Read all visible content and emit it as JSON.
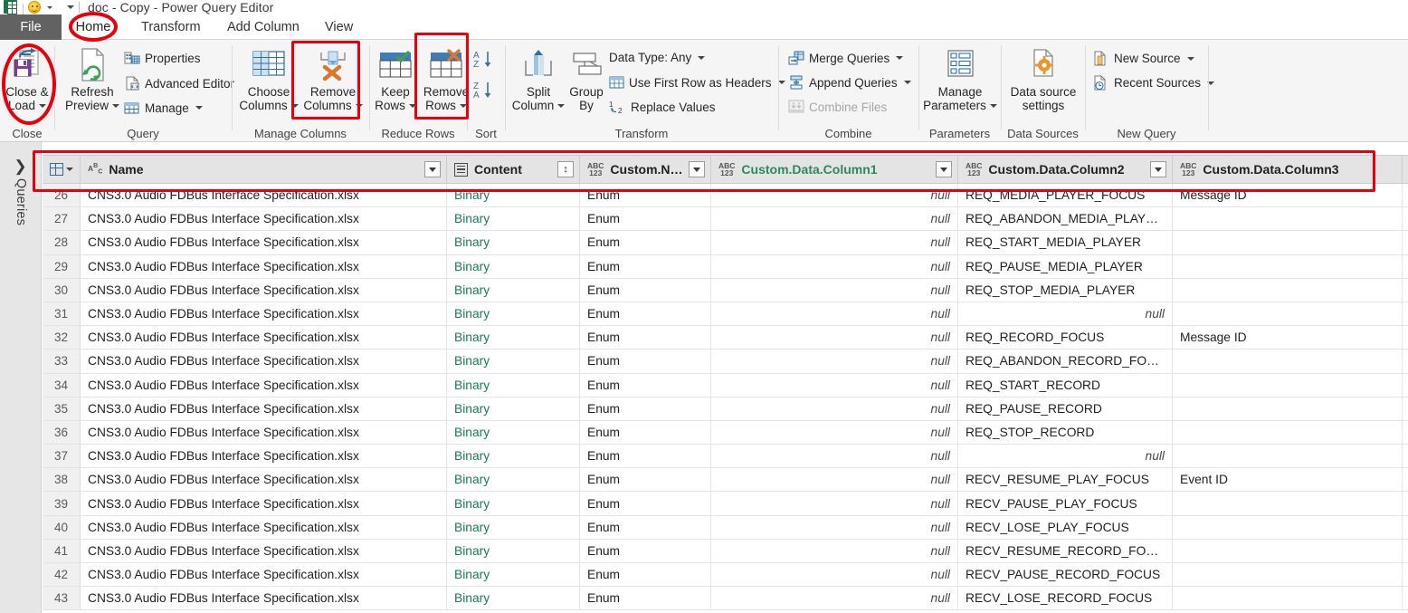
{
  "window": {
    "title": "doc - Copy - Power Query Editor",
    "qat_icons": [
      "excel-icon",
      "smiley-icon",
      "customize-quick-access-toolbar-icon"
    ]
  },
  "tabs": {
    "file_label": "File",
    "items": [
      {
        "label": "Home",
        "active": true
      },
      {
        "label": "Transform",
        "active": false
      },
      {
        "label": "Add Column",
        "active": false
      },
      {
        "label": "View",
        "active": false
      }
    ]
  },
  "ribbon": {
    "groups": [
      {
        "name": "Close",
        "label": "Close"
      },
      {
        "name": "Query",
        "label": "Query"
      },
      {
        "name": "Manage Columns",
        "label": "Manage Columns"
      },
      {
        "name": "Reduce Rows",
        "label": "Reduce Rows"
      },
      {
        "name": "Sort",
        "label": "Sort"
      },
      {
        "name": "Transform",
        "label": "Transform"
      },
      {
        "name": "Combine",
        "label": "Combine"
      },
      {
        "name": "Parameters",
        "label": "Parameters"
      },
      {
        "name": "Data Sources",
        "label": "Data Sources"
      },
      {
        "name": "New Query",
        "label": "New Query"
      }
    ],
    "close_load": {
      "line1": "Close &",
      "line2": "Load"
    },
    "refresh_preview": {
      "line1": "Refresh",
      "line2": "Preview"
    },
    "properties": "Properties",
    "advanced_editor": "Advanced Editor",
    "manage": "Manage",
    "choose_columns": {
      "line1": "Choose",
      "line2": "Columns"
    },
    "remove_columns": {
      "line1": "Remove",
      "line2": "Columns"
    },
    "keep_rows": {
      "line1": "Keep",
      "line2": "Rows"
    },
    "remove_rows": {
      "line1": "Remove",
      "line2": "Rows"
    },
    "sort_asc": "A\nZ",
    "sort_desc": "Z\nA",
    "split_column": {
      "line1": "Split",
      "line2": "Column"
    },
    "group_by": {
      "line1": "Group",
      "line2": "By"
    },
    "data_type": "Data Type: Any",
    "use_first_row_as_headers": "Use First Row as Headers",
    "replace_values": "Replace Values",
    "merge_queries": "Merge Queries",
    "append_queries": "Append Queries",
    "combine_files": "Combine Files",
    "manage_parameters": {
      "line1": "Manage",
      "line2": "Parameters"
    },
    "data_source_settings": {
      "line1": "Data source",
      "line2": "settings"
    },
    "new_source": "New Source",
    "recent_sources": "Recent Sources"
  },
  "sidebar": {
    "expand_icon": "chevron-right-icon",
    "label": "Queries"
  },
  "grid": {
    "columns": [
      {
        "name": "Name",
        "type_icon": "ABC",
        "has_filter": true,
        "highlight": false
      },
      {
        "name": "Content",
        "type_icon": "table",
        "has_expand": true,
        "highlight": false
      },
      {
        "name": "Custom.Name",
        "type_icon": "ABC123",
        "has_filter": true,
        "highlight": false
      },
      {
        "name": "Custom.Data.Column1",
        "type_icon": "ABC123",
        "has_filter": true,
        "highlight": true
      },
      {
        "name": "Custom.Data.Column2",
        "type_icon": "ABC123",
        "has_filter": true,
        "highlight": false
      },
      {
        "name": "Custom.Data.Column3",
        "type_icon": "ABC123",
        "has_filter": false,
        "highlight": false
      }
    ],
    "rows": [
      {
        "n": "26",
        "name": "CNS3.0 Audio FDBus Interface Specification.xlsx",
        "content": "Binary",
        "custom_name": "Enum",
        "col1": "null",
        "col1_null": true,
        "col2": "REQ_MEDIA_PLAYER_FOCUS",
        "col2_null": false,
        "col3": "Message ID"
      },
      {
        "n": "27",
        "name": "CNS3.0 Audio FDBus Interface Specification.xlsx",
        "content": "Binary",
        "custom_name": "Enum",
        "col1": "null",
        "col1_null": true,
        "col2": "REQ_ABANDON_MEDIA_PLAYER_F...",
        "col2_null": false,
        "col3": ""
      },
      {
        "n": "28",
        "name": "CNS3.0 Audio FDBus Interface Specification.xlsx",
        "content": "Binary",
        "custom_name": "Enum",
        "col1": "null",
        "col1_null": true,
        "col2": "REQ_START_MEDIA_PLAYER",
        "col2_null": false,
        "col3": ""
      },
      {
        "n": "29",
        "name": "CNS3.0 Audio FDBus Interface Specification.xlsx",
        "content": "Binary",
        "custom_name": "Enum",
        "col1": "null",
        "col1_null": true,
        "col2": "REQ_PAUSE_MEDIA_PLAYER",
        "col2_null": false,
        "col3": ""
      },
      {
        "n": "30",
        "name": "CNS3.0 Audio FDBus Interface Specification.xlsx",
        "content": "Binary",
        "custom_name": "Enum",
        "col1": "null",
        "col1_null": true,
        "col2": "REQ_STOP_MEDIA_PLAYER",
        "col2_null": false,
        "col3": ""
      },
      {
        "n": "31",
        "name": "CNS3.0 Audio FDBus Interface Specification.xlsx",
        "content": "Binary",
        "custom_name": "Enum",
        "col1": "null",
        "col1_null": true,
        "col2": "null",
        "col2_null": true,
        "col3": ""
      },
      {
        "n": "32",
        "name": "CNS3.0 Audio FDBus Interface Specification.xlsx",
        "content": "Binary",
        "custom_name": "Enum",
        "col1": "null",
        "col1_null": true,
        "col2": "REQ_RECORD_FOCUS",
        "col2_null": false,
        "col3": "Message ID"
      },
      {
        "n": "33",
        "name": "CNS3.0 Audio FDBus Interface Specification.xlsx",
        "content": "Binary",
        "custom_name": "Enum",
        "col1": "null",
        "col1_null": true,
        "col2": "REQ_ABANDON_RECORD_FOCUS",
        "col2_null": false,
        "col3": ""
      },
      {
        "n": "34",
        "name": "CNS3.0 Audio FDBus Interface Specification.xlsx",
        "content": "Binary",
        "custom_name": "Enum",
        "col1": "null",
        "col1_null": true,
        "col2": "REQ_START_RECORD",
        "col2_null": false,
        "col3": ""
      },
      {
        "n": "35",
        "name": "CNS3.0 Audio FDBus Interface Specification.xlsx",
        "content": "Binary",
        "custom_name": "Enum",
        "col1": "null",
        "col1_null": true,
        "col2": "REQ_PAUSE_RECORD",
        "col2_null": false,
        "col3": ""
      },
      {
        "n": "36",
        "name": "CNS3.0 Audio FDBus Interface Specification.xlsx",
        "content": "Binary",
        "custom_name": "Enum",
        "col1": "null",
        "col1_null": true,
        "col2": "REQ_STOP_RECORD",
        "col2_null": false,
        "col3": ""
      },
      {
        "n": "37",
        "name": "CNS3.0 Audio FDBus Interface Specification.xlsx",
        "content": "Binary",
        "custom_name": "Enum",
        "col1": "null",
        "col1_null": true,
        "col2": "null",
        "col2_null": true,
        "col3": ""
      },
      {
        "n": "38",
        "name": "CNS3.0 Audio FDBus Interface Specification.xlsx",
        "content": "Binary",
        "custom_name": "Enum",
        "col1": "null",
        "col1_null": true,
        "col2": "RECV_RESUME_PLAY_FOCUS",
        "col2_null": false,
        "col3": "Event ID"
      },
      {
        "n": "39",
        "name": "CNS3.0 Audio FDBus Interface Specification.xlsx",
        "content": "Binary",
        "custom_name": "Enum",
        "col1": "null",
        "col1_null": true,
        "col2": "RECV_PAUSE_PLAY_FOCUS",
        "col2_null": false,
        "col3": ""
      },
      {
        "n": "40",
        "name": "CNS3.0 Audio FDBus Interface Specification.xlsx",
        "content": "Binary",
        "custom_name": "Enum",
        "col1": "null",
        "col1_null": true,
        "col2": "RECV_LOSE_PLAY_FOCUS",
        "col2_null": false,
        "col3": ""
      },
      {
        "n": "41",
        "name": "CNS3.0 Audio FDBus Interface Specification.xlsx",
        "content": "Binary",
        "custom_name": "Enum",
        "col1": "null",
        "col1_null": true,
        "col2": "RECV_RESUME_RECORD_FOCUS",
        "col2_null": false,
        "col3": ""
      },
      {
        "n": "42",
        "name": "CNS3.0 Audio FDBus Interface Specification.xlsx",
        "content": "Binary",
        "custom_name": "Enum",
        "col1": "null",
        "col1_null": true,
        "col2": "RECV_PAUSE_RECORD_FOCUS",
        "col2_null": false,
        "col3": ""
      },
      {
        "n": "43",
        "name": "CNS3.0 Audio FDBus Interface Specification.xlsx",
        "content": "Binary",
        "custom_name": "Enum",
        "col1": "null",
        "col1_null": true,
        "col2": "RECV_LOSE_RECORD_FOCUS",
        "col2_null": false,
        "col3": ""
      }
    ]
  },
  "annotations": {
    "color": "#e8000d",
    "shapes": [
      {
        "kind": "ellipse",
        "target": "home-tab"
      },
      {
        "kind": "ellipse",
        "target": "close-and-load-button"
      },
      {
        "kind": "rect",
        "target": "remove-columns-button"
      },
      {
        "kind": "rect",
        "target": "remove-rows-button"
      },
      {
        "kind": "rect",
        "target": "column-headers-row"
      }
    ]
  },
  "colors": {
    "accent_green": "#2a8a5e",
    "link_green": "#1a7a55",
    "annotation_red": "#e8000d",
    "ribbon_bg": "#f5f5f5",
    "header_bg": "#e4e4e4",
    "rail_bg": "#e6e6e6",
    "file_tab_bg": "#626262"
  }
}
